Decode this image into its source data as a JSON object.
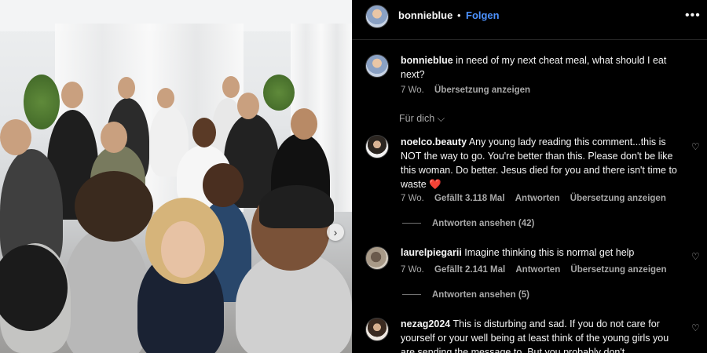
{
  "post": {
    "username": "bonnieblue",
    "separator": "•",
    "follow_label": "Folgen",
    "more_icon": "more-horizontal-icon",
    "next_icon": "chevron-right-icon"
  },
  "caption": {
    "username": "bonnieblue",
    "text": " in need of my next cheat meal, what should I eat next?",
    "age": "7 Wo.",
    "translate": "Übersetzung anzeigen"
  },
  "sort": {
    "label": "Für dich",
    "icon": "chevron-down-icon",
    "chevron": "⌵"
  },
  "comments": [
    {
      "username": "noelco.beauty",
      "text": " Any young lady reading this comment...this is NOT the way to go. You're better than this. Please don't be like this woman. Do better. Jesus died for you and there isn't time to waste ❤️",
      "age": "7 Wo.",
      "likes": "Gefällt 3.118 Mal",
      "reply": "Antworten",
      "translate": "Übersetzung anzeigen",
      "view_replies": "Antworten ansehen (42)"
    },
    {
      "username": "laurelpiegarii",
      "text": " Imagine thinking this is normal get help",
      "age": "7 Wo.",
      "likes": "Gefällt 2.141 Mal",
      "reply": "Antworten",
      "translate": "Übersetzung anzeigen",
      "view_replies": "Antworten ansehen (5)"
    },
    {
      "username": "nezag2024",
      "text": " This is disturbing and sad. If you do not care for yourself or your well being at least think of the young girls you are sending the message to. But you probably don't"
    }
  ],
  "colors": {
    "accent": "#4d92ff",
    "background": "#000000",
    "muted": "#a8a8a8"
  }
}
